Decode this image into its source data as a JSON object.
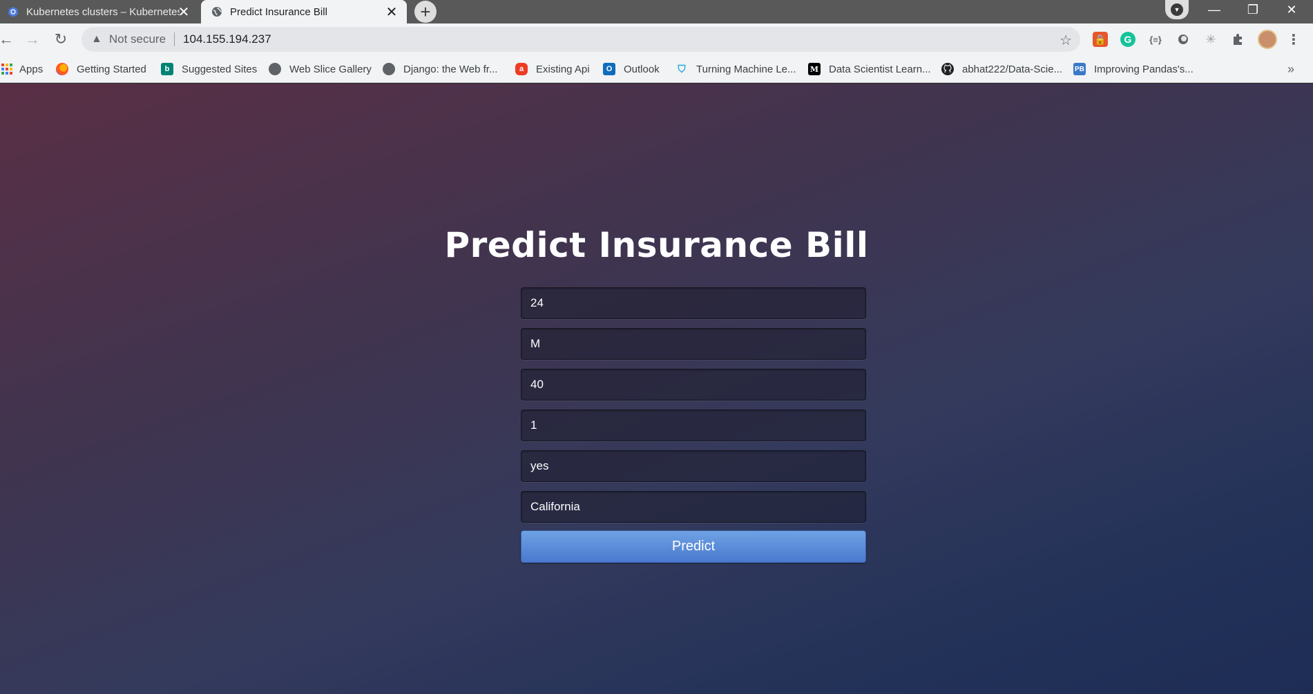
{
  "tabs": [
    {
      "title": "Kubernetes clusters – Kubernetes Engine",
      "icon": "kubernetes-icon"
    },
    {
      "title": "Predict Insurance Bill",
      "icon": "globe-icon"
    }
  ],
  "address_bar": {
    "security_label": "Not secure",
    "url": "104.155.194.237"
  },
  "bookmarks": [
    {
      "label": "Apps",
      "icon": "apps-grid-icon"
    },
    {
      "label": "Getting Started",
      "icon": "firefox-icon"
    },
    {
      "label": "Suggested Sites",
      "icon": "bing-icon"
    },
    {
      "label": "Web Slice Gallery",
      "icon": "globe-icon"
    },
    {
      "label": "Django: the Web fr...",
      "icon": "globe-icon"
    },
    {
      "label": "Existing Api",
      "icon": "api-icon"
    },
    {
      "label": "Outlook",
      "icon": "outlook-icon"
    },
    {
      "label": "Turning Machine Le...",
      "icon": "shield-icon"
    },
    {
      "label": "Data Scientist Learn...",
      "icon": "medium-icon"
    },
    {
      "label": "abhat222/Data-Scie...",
      "icon": "github-icon"
    },
    {
      "label": "Improving Pandas's...",
      "icon": "pb-icon"
    }
  ],
  "page": {
    "title": "Predict Insurance Bill",
    "form": {
      "fields": [
        "24",
        "M",
        "40",
        "1",
        "yes",
        "California"
      ],
      "submit_label": "Predict"
    }
  },
  "colors": {
    "accent_button": "#5a8ad9",
    "tab_active": "#f1f3f4",
    "tab_strip": "#595959"
  }
}
